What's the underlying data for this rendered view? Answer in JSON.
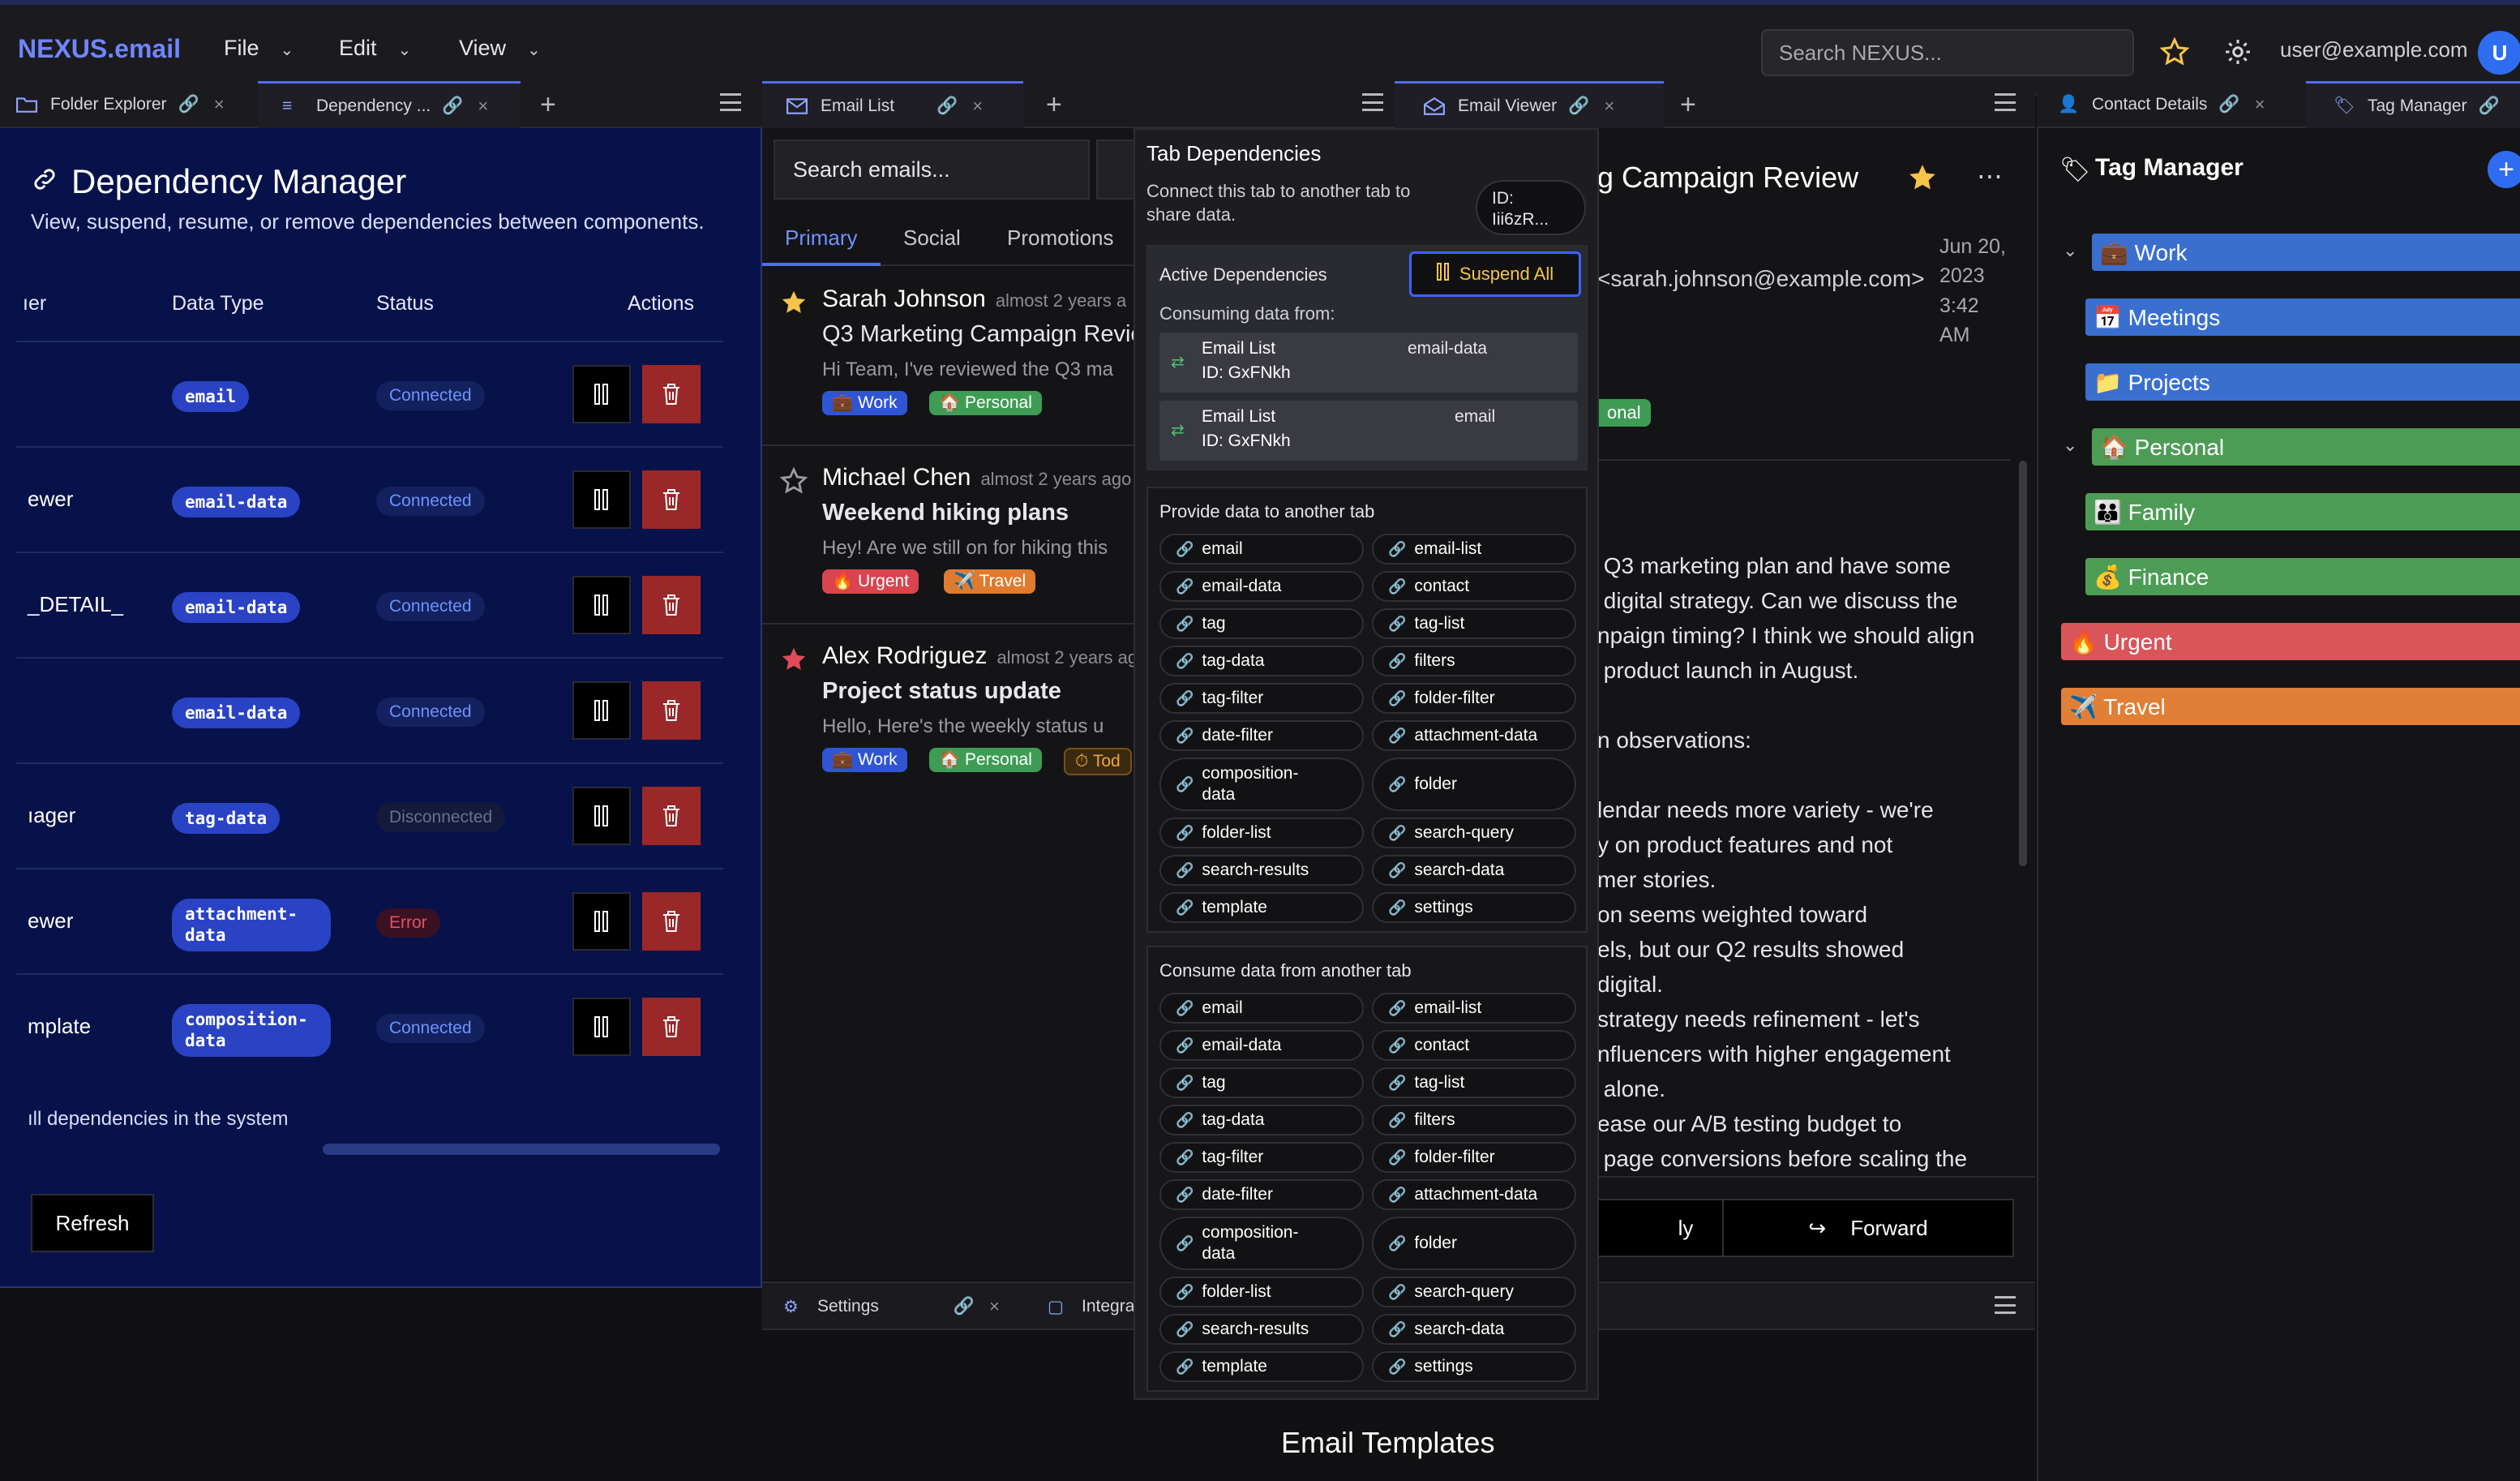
{
  "app": {
    "brand": "NEXUS.email"
  },
  "menu": {
    "file": "File",
    "edit": "Edit",
    "view": "View"
  },
  "topbar": {
    "search_placeholder": "Search NEXUS...",
    "user_email": "user@example.com",
    "avatar_initial": "U"
  },
  "tabs_left": {
    "folder_explorer": "Folder Explorer",
    "dependency": "Dependency ..."
  },
  "tabs_email_list": {
    "email_list": "Email List"
  },
  "tabs_viewer": {
    "email_viewer": "Email Viewer"
  },
  "tabs_right": {
    "contact_details": "Contact Details",
    "tag_manager": "Tag Manager"
  },
  "dependency_manager": {
    "title": "Dependency Manager",
    "subtitle": "View, suspend, resume, or remove dependencies between components.",
    "headers": {
      "consumer": "ıer",
      "data_type": "Data Type",
      "status": "Status",
      "actions": "Actions"
    },
    "rows": [
      {
        "consumer": "",
        "type": "email",
        "status": "Connected",
        "status_kind": "connected"
      },
      {
        "consumer": "ewer",
        "type": "email-data",
        "status": "Connected",
        "status_kind": "connected"
      },
      {
        "consumer": "_DETAIL_",
        "type": "email-data",
        "status": "Connected",
        "status_kind": "connected"
      },
      {
        "consumer": "",
        "type": "email-data",
        "status": "Connected",
        "status_kind": "connected"
      },
      {
        "consumer": "ıager",
        "type": "tag-data",
        "status": "Disconnected",
        "status_kind": "disconnected"
      },
      {
        "consumer": "ewer",
        "type": "attachment-\ndata",
        "status": "Error",
        "status_kind": "error"
      },
      {
        "consumer": "mplate",
        "type": "composition-\ndata",
        "status": "Connected",
        "status_kind": "connected"
      }
    ],
    "footer_note": "ıll dependencies in the system",
    "refresh": "Refresh"
  },
  "email_list": {
    "search_placeholder": "Search emails...",
    "subtabs": [
      "Primary",
      "Social",
      "Promotions"
    ],
    "emails": [
      {
        "sender": "Sarah Johnson",
        "time": "almost 2 years a",
        "subject": "Q3 Marketing Campaign Revie",
        "preview": "Hi Team, I've reviewed the Q3 ma",
        "starred": true,
        "tags": [
          {
            "label": "💼 Work",
            "color": "#2f55d4"
          },
          {
            "label": "🏠 Personal",
            "color": "#3f9c55"
          }
        ]
      },
      {
        "sender": "Michael Chen",
        "time": "almost 2 years ago",
        "subject": "Weekend hiking plans",
        "preview": "Hey! Are we still on for hiking this",
        "starred": false,
        "tags": [
          {
            "label": "🔥 Urgent",
            "color": "#d9444f"
          },
          {
            "label": "✈️ Travel",
            "color": "#e07b2e"
          }
        ]
      },
      {
        "sender": "Alex Rodriguez",
        "time": "almost 2 years ago",
        "subject": "Project status update",
        "preview": "Hello, Here's the weekly status u",
        "starred": true,
        "tags": [
          {
            "label": "💼 Work",
            "color": "#2f55d4"
          },
          {
            "label": "🏠 Personal",
            "color": "#3f9c55"
          },
          {
            "label": "⏱ Tod",
            "color": "#3a2a10"
          }
        ]
      }
    ]
  },
  "viewer": {
    "title": "g Campaign Review",
    "from": "<sarah.johnson@example.com>",
    "date": "Jun 20,\n2023\n3:42\nAM",
    "tag_partial": "onal",
    "body": " Q3 marketing plan and have some\n digital strategy. Can we discuss the\nnpaign timing? I think we should align\n product launch in August.\n\nn observations:\n\nlendar needs more variety - we're\ny on product features and not\nmer stories.\non seems weighted toward\nels, but our Q2 results showed\ndigital.\nstrategy needs refinement - let's\nnfluencers with higher engagement\n alone.\nease our A/B testing budget to\n page conversions before scaling the",
    "reply": "ly",
    "forward": "Forward"
  },
  "bottom": {
    "settings": "Settings",
    "integrations": "Integra",
    "templates_title": "Email Templates"
  },
  "tag_manager": {
    "title": "Tag Manager",
    "tags": [
      {
        "label": "💼 Work",
        "color": "#3a6fd0",
        "level": 0,
        "expanded": true
      },
      {
        "label": "📅 Meetings",
        "color": "#3a6fd0",
        "level": 1
      },
      {
        "label": "📁 Projects",
        "color": "#3a6fd0",
        "level": 1
      },
      {
        "label": "🏠 Personal",
        "color": "#4d9c55",
        "level": 0,
        "expanded": true
      },
      {
        "label": "👪 Family",
        "color": "#4d9c55",
        "level": 1
      },
      {
        "label": "💰 Finance",
        "color": "#4d9c55",
        "level": 1
      },
      {
        "label": "🔥 Urgent",
        "color": "#d9555a",
        "level": -1
      },
      {
        "label": "✈️ Travel",
        "color": "#e07f35",
        "level": -1
      }
    ]
  },
  "popover": {
    "title": "Tab Dependencies",
    "description": "Connect this tab to another tab to share data.",
    "id_label": "ID:\nIii6zR...",
    "active_title": "Active Dependencies",
    "suspend_all": "Suspend All",
    "consuming_label": "Consuming data from:",
    "deps": [
      {
        "name": "Email List",
        "id": "ID: GxFNkh",
        "type": "email-data"
      },
      {
        "name": "Email List",
        "id": "ID: GxFNkh",
        "type": "email"
      }
    ],
    "provide_title": "Provide data to another tab",
    "consume_title": "Consume data from another tab",
    "chips": [
      "email",
      "email-list",
      "email-data",
      "contact",
      "tag",
      "tag-list",
      "tag-data",
      "filters",
      "tag-filter",
      "folder-filter",
      "date-filter",
      "attachment-data",
      "composition-\ndata",
      "folder",
      "folder-list",
      "search-query",
      "search-results",
      "search-data",
      "template",
      "settings"
    ]
  },
  "colors": {
    "accent": "#4f6cff",
    "brand": "#6f86ff",
    "danger": "#9a2828",
    "panel_navy": "#07124a"
  }
}
